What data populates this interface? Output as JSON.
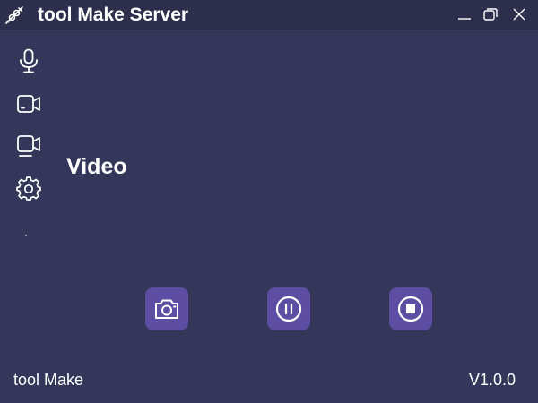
{
  "window": {
    "title": "tool Make Server",
    "app_icon": "wrench-icon",
    "controls": [
      "minimize-icon",
      "maximize-icon",
      "close-icon"
    ]
  },
  "sidebar": {
    "items": [
      {
        "icon": "microphone-icon"
      },
      {
        "icon": "camera-icon"
      },
      {
        "icon": "screen-record-icon"
      },
      {
        "icon": "gear-icon"
      }
    ]
  },
  "main": {
    "section_title": "Video",
    "actions": [
      {
        "icon": "camera-snapshot-icon"
      },
      {
        "icon": "pause-icon"
      },
      {
        "icon": "stop-icon"
      }
    ]
  },
  "footer": {
    "app_name": "tool Make",
    "version": "V1.0.0"
  },
  "colors": {
    "background": "#34375a",
    "titlebar": "#2d2f4c",
    "accent": "#5d4ea3",
    "text": "#ffffff"
  }
}
